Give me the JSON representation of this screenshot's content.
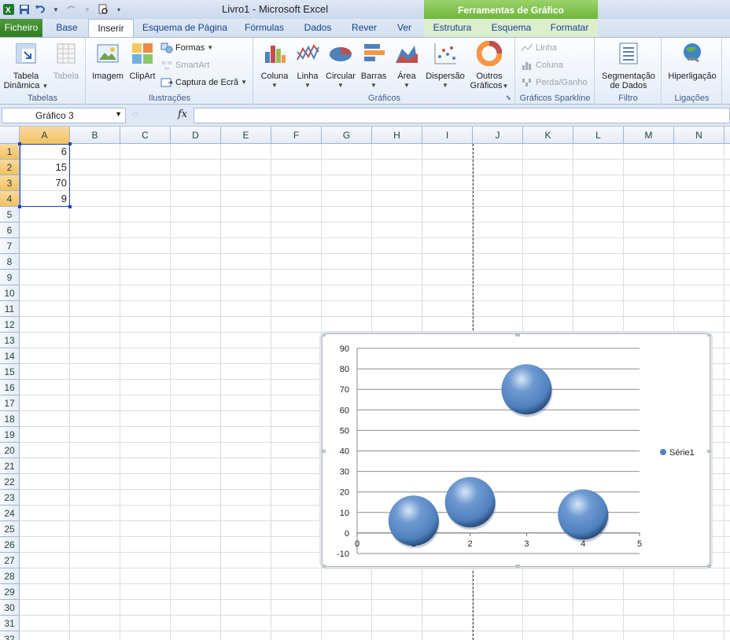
{
  "window": {
    "title": "Livro1  -  Microsoft Excel",
    "context_tab_group": "Ferramentas de Gráfico"
  },
  "tabs": [
    {
      "label": "Ficheiro"
    },
    {
      "label": "Base"
    },
    {
      "label": "Inserir"
    },
    {
      "label": "Esquema de Página"
    },
    {
      "label": "Fórmulas"
    },
    {
      "label": "Dados"
    },
    {
      "label": "Rever"
    },
    {
      "label": "Ver"
    },
    {
      "label": "Estrutura"
    },
    {
      "label": "Esquema"
    },
    {
      "label": "Formatar"
    }
  ],
  "ribbon": {
    "groups": {
      "tabelas": "Tabelas",
      "ilustracoes": "Ilustrações",
      "graficos": "Gráficos",
      "sparkline": "Gráficos Sparkline",
      "filtro": "Filtro",
      "ligacoes": "Ligações"
    },
    "tabela_dinamica": [
      "Tabela",
      "Dinâmica"
    ],
    "tabela": "Tabela",
    "imagem": "Imagem",
    "clipart": "ClipArt",
    "formas": "Formas",
    "smartart": "SmartArt",
    "captura": "Captura de Ecrã",
    "coluna": "Coluna",
    "linha": "Linha",
    "circular": "Circular",
    "barras": "Barras",
    "area": "Área",
    "dispersao": "Dispersão",
    "outros": [
      "Outros",
      "Gráficos"
    ],
    "spark_linha": "Linha",
    "spark_coluna": "Coluna",
    "spark_perda": "Perda/Ganho",
    "segmentacao": [
      "Segmentação",
      "de Dados"
    ],
    "hiperligacao": "Hiperligação"
  },
  "formula_bar": {
    "name_box": "Gráfico 3",
    "fx": "fx",
    "formula": ""
  },
  "sheet": {
    "columns": [
      "A",
      "B",
      "C",
      "D",
      "E",
      "F",
      "G",
      "H",
      "I",
      "J",
      "K",
      "L",
      "M",
      "N"
    ],
    "rows": [
      "1",
      "2",
      "3",
      "4",
      "5",
      "6",
      "7",
      "8",
      "9",
      "10",
      "11",
      "12",
      "13",
      "14",
      "15",
      "16",
      "17",
      "18",
      "19",
      "20",
      "21",
      "22",
      "23",
      "24",
      "25",
      "26",
      "27",
      "28",
      "29",
      "30",
      "31",
      "32"
    ],
    "cells": {
      "A1": "6",
      "A2": "15",
      "A3": "70",
      "A4": "9"
    }
  },
  "colors": {
    "bubble": "#4f81bd",
    "file_tab": "#2f7d21",
    "selection": "#2040c0"
  },
  "chart_data": {
    "type": "scatter",
    "x": [
      1,
      2,
      3,
      4
    ],
    "series": [
      {
        "name": "Série1",
        "values": [
          6,
          15,
          70,
          9
        ]
      }
    ],
    "xlim": [
      0,
      5
    ],
    "ylim": [
      -10,
      90
    ],
    "x_ticks": [
      "0",
      "1",
      "2",
      "3",
      "4",
      "5"
    ],
    "y_ticks": [
      "-10",
      "0",
      "10",
      "20",
      "30",
      "40",
      "50",
      "60",
      "70",
      "80",
      "90"
    ],
    "grid": "horizontal",
    "legend": "right"
  }
}
